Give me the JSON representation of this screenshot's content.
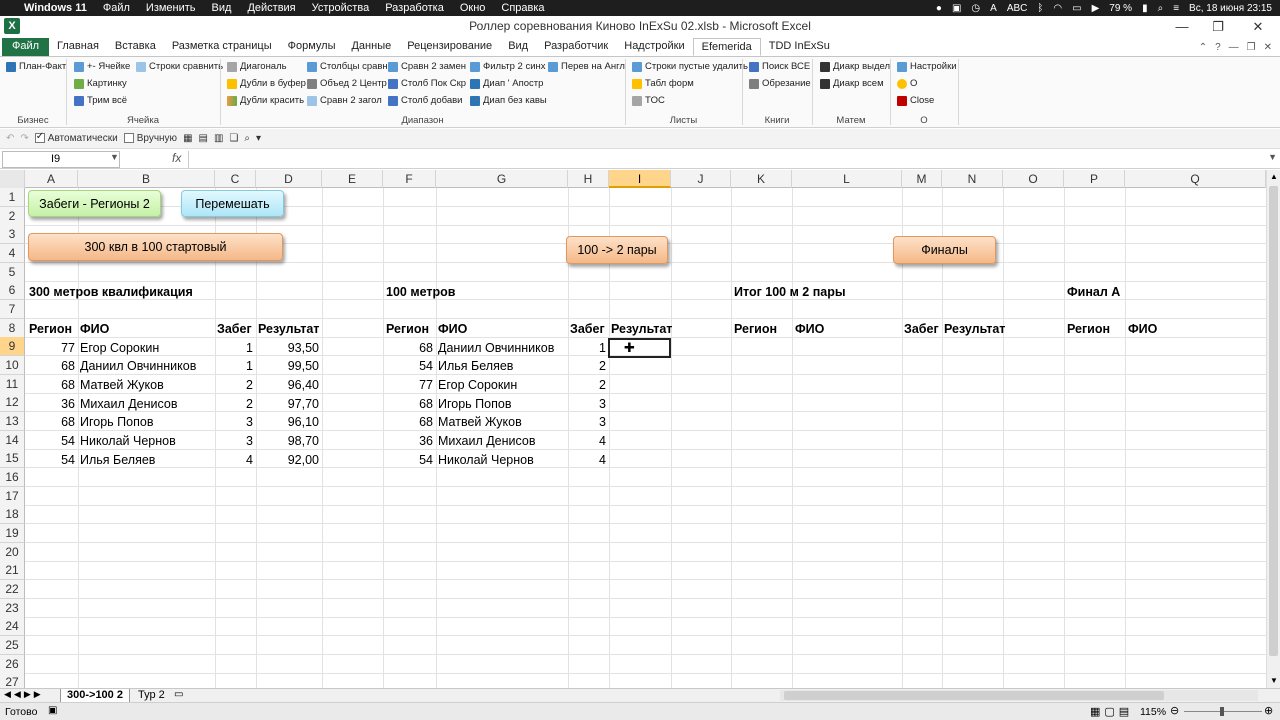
{
  "macbar": {
    "app": "Windows 11",
    "menus": [
      "Файл",
      "Изменить",
      "Вид",
      "Действия",
      "Устройства",
      "Разработка",
      "Окно",
      "Справка"
    ],
    "battery": "79 %",
    "input": "ABC",
    "datetime": "Вс, 18 июня  23:15"
  },
  "window": {
    "title": "Роллер соревнования Киново InExSu 02.xlsb - Microsoft Excel"
  },
  "tabs": [
    "Главная",
    "Вставка",
    "Разметка страницы",
    "Формулы",
    "Данные",
    "Рецензирование",
    "Вид",
    "Разработчик",
    "Надстройки",
    "Efemerida",
    "TDD InExSu"
  ],
  "file_tab": "Файл",
  "ribbon": {
    "biz": {
      "btn": "План-Факт",
      "group": "Бизнес"
    },
    "cell": {
      "btns": [
        "+- Ячейке",
        "Строки сравнить",
        "Картинку",
        "Трим всё"
      ],
      "group": "Ячейка"
    },
    "range": {
      "btns": [
        "Диагональ",
        "Дубли в буфер",
        "Дубли красить",
        "Столбцы сравн",
        "Объед 2 Центр",
        "Сравн 2 загол",
        "Сравн 2 замен",
        "Столб Пок Скр",
        "Столб добави",
        "Фильтр 2 синх",
        "Диап ' Апостр",
        "Диап без кавы",
        "Перев на Англ"
      ],
      "group": "Диапазон"
    },
    "sheets": {
      "btns": [
        "Строки пустые удалить",
        "Табл форм",
        "TOC"
      ],
      "group": "Листы"
    },
    "books": {
      "btns": [
        "Поиск ВСЕ",
        "Обрезание"
      ],
      "group": "Книги"
    },
    "math": {
      "btns": [
        "Диакр выдел",
        "Диакр всем"
      ],
      "group": "Матем"
    },
    "o": {
      "btns": [
        "Настройки",
        "О",
        "Close"
      ],
      "group": "О"
    }
  },
  "qat": {
    "auto": "Автоматически",
    "manual": "Вручную"
  },
  "namebox": "I9",
  "fx": "fx",
  "columns": [
    "A",
    "B",
    "C",
    "D",
    "E",
    "F",
    "G",
    "H",
    "I",
    "J",
    "K",
    "L",
    "M",
    "N",
    "O",
    "P",
    "Q"
  ],
  "rows": [
    "1",
    "2",
    "3",
    "4",
    "5",
    "6",
    "7",
    "8",
    "9",
    "10",
    "11",
    "12",
    "13",
    "14",
    "15",
    "16",
    "17",
    "18",
    "19",
    "20",
    "21",
    "22",
    "23",
    "24",
    "25",
    "26",
    "27"
  ],
  "shapes": {
    "heats": "Забеги - Регионы 2",
    "shuffle": "Перемешать",
    "qual": "300 квл в 100 стартовый",
    "pairs": "100 -> 2 пары",
    "finals": "Финалы"
  },
  "sections": {
    "s300": "300 метров квалификация",
    "s100": "100 метров",
    "itog": "Итог 100 м 2 пары",
    "finalA": "Финал А"
  },
  "headers": {
    "region": "Регион",
    "fio": "ФИО",
    "heat": "Забег",
    "result": "Результат"
  },
  "table300": [
    {
      "region": "77",
      "fio": "Егор Сорокин",
      "heat": "1",
      "result": "93,50"
    },
    {
      "region": "68",
      "fio": "Даниил Овчинников",
      "heat": "1",
      "result": "99,50"
    },
    {
      "region": "68",
      "fio": "Матвей Жуков",
      "heat": "2",
      "result": "96,40"
    },
    {
      "region": "36",
      "fio": "Михаил Денисов",
      "heat": "2",
      "result": "97,70"
    },
    {
      "region": "68",
      "fio": "Игорь Попов",
      "heat": "3",
      "result": "96,10"
    },
    {
      "region": "54",
      "fio": "Николай Чернов",
      "heat": "3",
      "result": "98,70"
    },
    {
      "region": "54",
      "fio": "Илья Беляев",
      "heat": "4",
      "result": "92,00"
    }
  ],
  "table100": [
    {
      "region": "68",
      "fio": "Даниил Овчинников",
      "heat": "1"
    },
    {
      "region": "54",
      "fio": "Илья Беляев",
      "heat": "2"
    },
    {
      "region": "77",
      "fio": "Егор Сорокин",
      "heat": "2"
    },
    {
      "region": "68",
      "fio": "Игорь Попов",
      "heat": "3"
    },
    {
      "region": "68",
      "fio": "Матвей Жуков",
      "heat": "3"
    },
    {
      "region": "36",
      "fio": "Михаил Денисов",
      "heat": "4"
    },
    {
      "region": "54",
      "fio": "Николай Чернов",
      "heat": "4"
    }
  ],
  "sheet_tabs": [
    "300->100 2",
    "Тур 2"
  ],
  "status": {
    "ready": "Готово",
    "zoom": "115%"
  }
}
